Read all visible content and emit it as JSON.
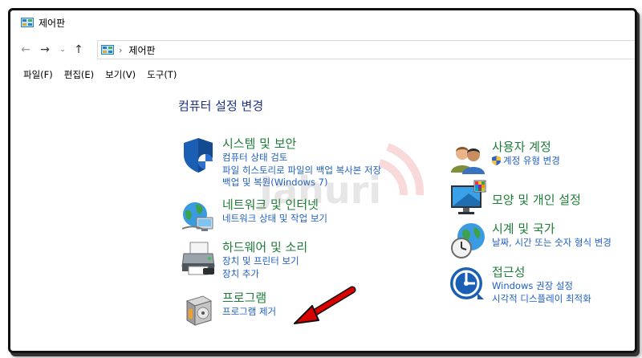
{
  "window": {
    "title": "제어판"
  },
  "address": {
    "path": "제어판"
  },
  "menu": [
    "파일(F)",
    "편집(E)",
    "보기(V)",
    "도구(T)"
  ],
  "heading": "컴퓨터 설정 변경",
  "left_categories": [
    {
      "title": "시스템 및 보안",
      "links": [
        "컴퓨터 상태 검토",
        "파일 히스토리로 파일의 백업 복사본 저장",
        "백업 및 복원(Windows 7)"
      ],
      "icon": "shield-icon"
    },
    {
      "title": "네트워크 및 인터넷",
      "links": [
        "네트워크 상태 및 작업 보기"
      ],
      "icon": "network-globe-icon"
    },
    {
      "title": "하드웨어 및 소리",
      "links": [
        "장치 및 프린터 보기",
        "장치 추가"
      ],
      "icon": "printer-icon"
    },
    {
      "title": "프로그램",
      "links": [
        "프로그램 제거"
      ],
      "icon": "program-box-icon"
    }
  ],
  "right_categories": [
    {
      "title": "사용자 계정",
      "links": [
        "계정 유형 변경"
      ],
      "icon": "users-icon"
    },
    {
      "title": "모양 및 개인 설정",
      "links": [],
      "icon": "monitor-icon"
    },
    {
      "title": "시계 및 국가",
      "links": [
        "날짜, 시간 또는 숫자 형식 변경"
      ],
      "icon": "clock-globe-icon"
    },
    {
      "title": "접근성",
      "links": [
        "Windows 권장 설정",
        "시각적 디스플레이 최적화"
      ],
      "icon": "accessibility-icon"
    }
  ],
  "colors": {
    "heading": "#1e3287",
    "category_title": "#1e7c3a",
    "link": "#1f5fc4",
    "annotation_arrow": "#d90000"
  }
}
